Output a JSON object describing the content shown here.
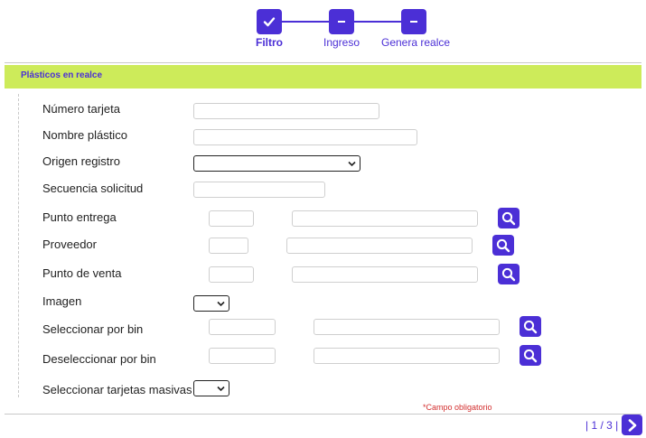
{
  "stepper": {
    "steps": [
      {
        "label": "Filtro",
        "state": "done"
      },
      {
        "label": "Ingreso",
        "state": "pending"
      },
      {
        "label": "Genera realce",
        "state": "pending"
      }
    ]
  },
  "section": {
    "title": "Plásticos en realce"
  },
  "form": {
    "fields": [
      {
        "label": "Número tarjeta",
        "value": ""
      },
      {
        "label": "Nombre plástico",
        "value": ""
      },
      {
        "label": "Origen registro",
        "value": ""
      },
      {
        "label": "Secuencia solicitud",
        "value": ""
      },
      {
        "label": "Punto entrega",
        "code": "",
        "description": ""
      },
      {
        "label": "Proveedor",
        "code": "",
        "description": ""
      },
      {
        "label": "Punto de venta",
        "code": "",
        "description": ""
      },
      {
        "label": "Imagen",
        "value": ""
      },
      {
        "label": "Seleccionar por bin",
        "from": "",
        "to": ""
      },
      {
        "label": "Deseleccionar por bin",
        "from": "",
        "to": ""
      },
      {
        "label": "Seleccionar tarjetas masivas",
        "value": ""
      }
    ]
  },
  "footer": {
    "required_note": "*Campo obligatorio",
    "pager": "| 1 / 3 |"
  },
  "colors": {
    "accent": "#4b2fd6",
    "section_bg": "#cdeb5a",
    "required": "#d32f2f"
  },
  "icons": {
    "done_step": "check-icon",
    "pending_step": "minus-icon",
    "lookup": "search-icon",
    "next": "chevron-right-icon"
  }
}
